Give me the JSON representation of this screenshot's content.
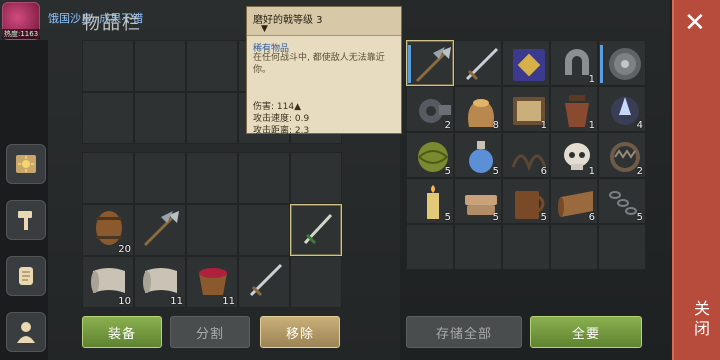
{
  "title": "物品栏",
  "notice": {
    "badge": "热度:1163",
    "message": "饿国沙皇: 成果不错"
  },
  "tooltip": {
    "title": "磨好的戟等级 3",
    "arrow": "▼",
    "rarity": "稀有物品",
    "description": "在任何战斗中, 都使敌人无法靠近你。",
    "damage": "伤害: 114▲",
    "attack_speed": "攻击速度: 0.9",
    "attack_range": "攻击距离: 2.3"
  },
  "buttons": {
    "equip": "装备",
    "split": "分割",
    "remove": "移除",
    "store_all": "存储全部",
    "all": "全要"
  },
  "close": {
    "icon": "✕",
    "label": "关闭"
  },
  "nav_icons": [
    "sun-book-icon",
    "hammer-icon",
    "scroll-icon",
    "character-icon"
  ],
  "inventory_items": [
    {
      "slot": 10,
      "icon": "barrel",
      "qty": "20"
    },
    {
      "slot": 11,
      "icon": "halberd",
      "qty": ""
    },
    {
      "slot": 14,
      "icon": "sword-dagger",
      "qty": ""
    },
    {
      "slot": 15,
      "icon": "cloth-roll",
      "qty": "10"
    },
    {
      "slot": 16,
      "icon": "cloth-roll",
      "qty": "11"
    },
    {
      "slot": 17,
      "icon": "berry-bucket",
      "qty": "11"
    },
    {
      "slot": 18,
      "icon": "sword",
      "qty": ""
    }
  ],
  "storage_items": [
    {
      "slot": 0,
      "icon": "halberd",
      "qty": "",
      "rarity": "#5aa0e0"
    },
    {
      "slot": 1,
      "icon": "sword",
      "qty": ""
    },
    {
      "slot": 2,
      "icon": "tome",
      "qty": ""
    },
    {
      "slot": 3,
      "icon": "horseshoe-magnet",
      "qty": "1"
    },
    {
      "slot": 4,
      "icon": "round-shield",
      "qty": "",
      "rarity": "#5aa0e0"
    },
    {
      "slot": 5,
      "icon": "gear-mechanism",
      "qty": "2"
    },
    {
      "slot": 6,
      "icon": "grain-sack",
      "qty": "8"
    },
    {
      "slot": 7,
      "icon": "tablet",
      "qty": "1"
    },
    {
      "slot": 8,
      "icon": "leather-flask",
      "qty": "1"
    },
    {
      "slot": 9,
      "icon": "crystal-ore",
      "qty": "4"
    },
    {
      "slot": 10,
      "icon": "green-orb",
      "qty": "5"
    },
    {
      "slot": 11,
      "icon": "potion-bottle",
      "qty": "5"
    },
    {
      "slot": 12,
      "icon": "rope",
      "qty": "6"
    },
    {
      "slot": 13,
      "icon": "skull",
      "qty": "1"
    },
    {
      "slot": 14,
      "icon": "bear-trap",
      "qty": "2"
    },
    {
      "slot": 15,
      "icon": "candle",
      "qty": "5"
    },
    {
      "slot": 16,
      "icon": "folded-cloth",
      "qty": "5"
    },
    {
      "slot": 17,
      "icon": "mug",
      "qty": "5"
    },
    {
      "slot": 18,
      "icon": "leather-roll",
      "qty": "6"
    },
    {
      "slot": 19,
      "icon": "chain",
      "qty": "5"
    }
  ],
  "colors": {
    "close": "#b74b3c",
    "green_button": "#7aa043",
    "tooltip_bg": "#e8dcc0",
    "link_text": "#8fc6ff"
  }
}
